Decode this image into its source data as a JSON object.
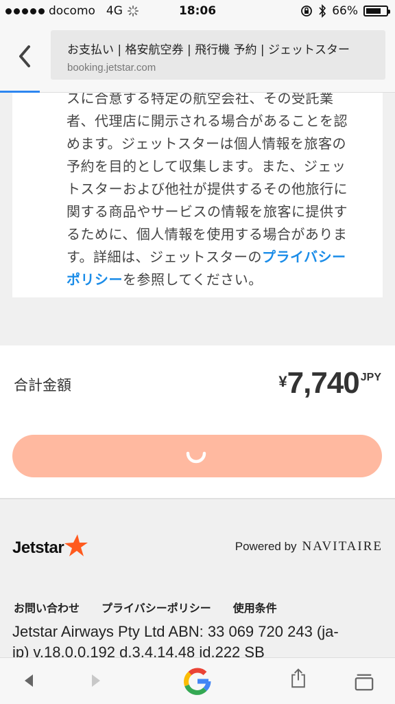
{
  "status_bar": {
    "carrier": "docomo",
    "network": "4G",
    "time": "18:06",
    "battery": "66%"
  },
  "browser": {
    "page_title": "お支払い | 格安航空券 | 飛行機 予約 | ジェットスター",
    "url": "booking.jetstar.com"
  },
  "terms": {
    "lines": [
      "スに合意する特定の航空会社、その受託業",
      "者、代理店に開示される場合があることを認",
      "めます。ジェットスターは個人情報を旅客の",
      "予約を目的として収集します。また、ジェッ",
      "トスターおよび他社が提供するその他旅行に",
      "関する商品やサービスの情報を旅客に提供す",
      "るために、個人情報を使用する場合がありま"
    ],
    "line8_before": "す。詳細は、ジェットスターの",
    "link_part1": "プライバシー",
    "link_part2": "ポリシー",
    "line9_after": "を参照してください。"
  },
  "total": {
    "label": "合計金額",
    "currency_symbol": "¥",
    "amount": "7,740",
    "unit": "JPY"
  },
  "footer": {
    "logo_text": "Jetstar",
    "powered_by": "Powered by",
    "navitaire": "NAVITAIRE",
    "links": [
      "お問い合わせ",
      "プライバシーポリシー",
      "使用条件"
    ],
    "company_line1": "Jetstar Airways Pty Ltd ABN: 33 069 720 243 (ja-",
    "company_line2": "jp) v.18.0.0.192 d.3.4.14.48 id.222 SB"
  },
  "colors": {
    "link": "#1a8ce8",
    "pay_button": "#ffb9a0",
    "jetstar_orange": "#ff5a1e",
    "progress": "#2d86f0"
  }
}
